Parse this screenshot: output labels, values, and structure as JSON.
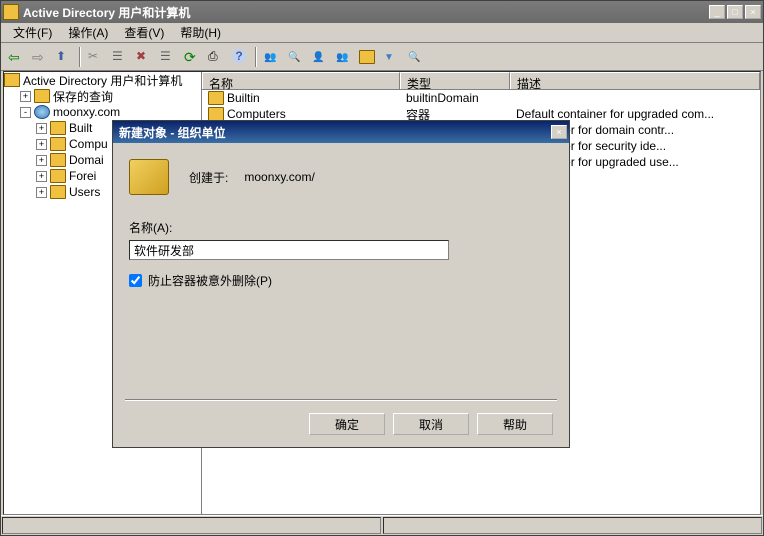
{
  "main": {
    "title": "Active Directory 用户和计算机",
    "menus": [
      "文件(F)",
      "操作(A)",
      "查看(V)",
      "帮助(H)"
    ]
  },
  "tree": {
    "root": "Active Directory 用户和计算机",
    "saved_queries": "保存的查询",
    "domain": "moonxy.com",
    "children": [
      "Built",
      "Compu",
      "Domai",
      "Forei",
      "Users"
    ]
  },
  "list": {
    "headers": {
      "name": "名称",
      "type": "类型",
      "desc": "描述"
    },
    "col_widths": {
      "name": 198,
      "type": 110,
      "desc": 260
    },
    "rows": [
      {
        "name": "Builtin",
        "type": "builtinDomain",
        "desc": ""
      },
      {
        "name": "Computers",
        "type": "容器",
        "desc": "Default container for upgraded com..."
      },
      {
        "name": "",
        "type": "",
        "desc": "lt container for domain contr..."
      },
      {
        "name": "",
        "type": "",
        "desc": "lt container for security ide..."
      },
      {
        "name": "",
        "type": "",
        "desc": "lt container for upgraded use..."
      }
    ]
  },
  "dialog": {
    "title": "新建对象 - 组织单位",
    "created_in_label": "创建于:",
    "created_in_value": "moonxy.com/",
    "name_label": "名称(A):",
    "name_value": "软件研发部",
    "protect_label": "防止容器被意外删除(P)",
    "protect_checked": true,
    "buttons": {
      "ok": "确定",
      "cancel": "取消",
      "help": "帮助"
    }
  }
}
